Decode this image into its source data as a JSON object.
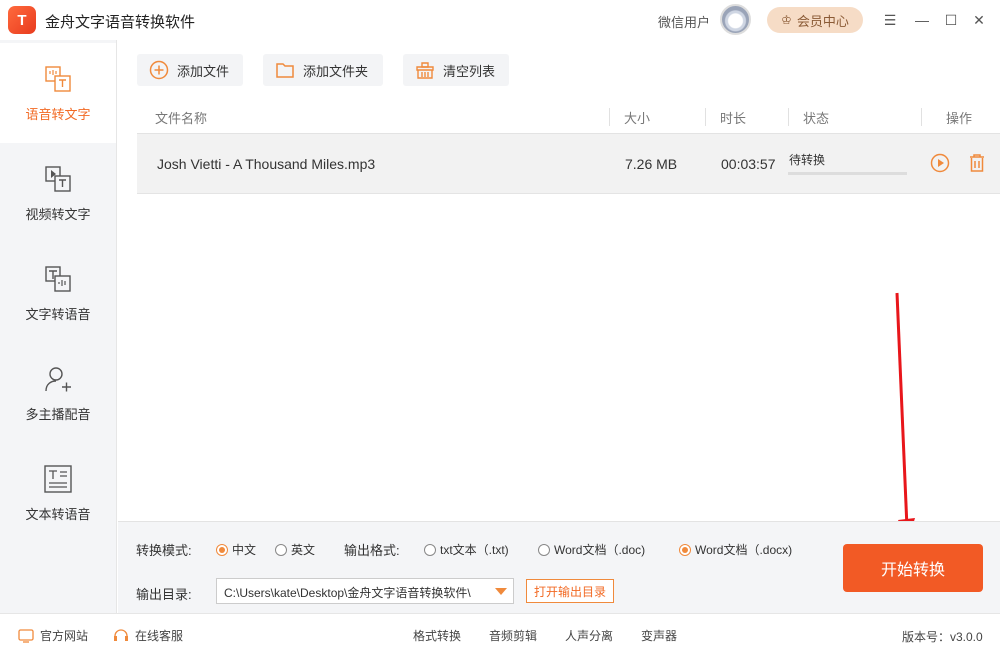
{
  "app": {
    "title": "金舟文字语音转换软件",
    "logo_text": "T"
  },
  "user": {
    "name": "微信用户"
  },
  "vip": {
    "label": "会员中心"
  },
  "window": {
    "menu": "☰",
    "min": "—",
    "max": "☐",
    "close": "✕"
  },
  "sidebar": {
    "items": [
      {
        "label": "语音转文字",
        "icon": "speech-to-text-icon"
      },
      {
        "label": "视频转文字",
        "icon": "video-to-text-icon"
      },
      {
        "label": "文字转语音",
        "icon": "text-to-speech-icon"
      },
      {
        "label": "多主播配音",
        "icon": "multi-speaker-icon"
      },
      {
        "label": "文本转语音",
        "icon": "document-to-speech-icon"
      }
    ],
    "active_index": 0
  },
  "toolbar": {
    "add_file": "添加文件",
    "add_folder": "添加文件夹",
    "clear_list": "清空列表"
  },
  "table": {
    "headers": {
      "name": "文件名称",
      "size": "大小",
      "duration": "时长",
      "status": "状态",
      "actions": "操作"
    },
    "rows": [
      {
        "name": "Josh Vietti - A Thousand Miles.mp3",
        "size": "7.26 MB",
        "duration": "00:03:57",
        "status": "待转换",
        "progress": 0
      }
    ]
  },
  "options": {
    "mode_label": "转换模式:",
    "modes": [
      "中文",
      "英文"
    ],
    "mode_selected": 0,
    "format_label": "输出格式:",
    "formats": [
      "txt文本（.txt)",
      "Word文档（.doc)",
      "Word文档（.docx)"
    ],
    "format_selected": 2,
    "dir_label": "输出目录:",
    "dir_value": "C:\\Users\\kate\\Desktop\\金舟文字语音转换软件\\",
    "open_dir": "打开输出目录",
    "start": "开始转换"
  },
  "footer": {
    "website": "官方网站",
    "support": "在线客服",
    "links": [
      "格式转换",
      "音频剪辑",
      "人声分离",
      "变声器"
    ],
    "version": "版本号：v3.0.0"
  },
  "colors": {
    "accent": "#f26a24",
    "start_button": "#f25a25",
    "arrow": "#e8161b"
  }
}
